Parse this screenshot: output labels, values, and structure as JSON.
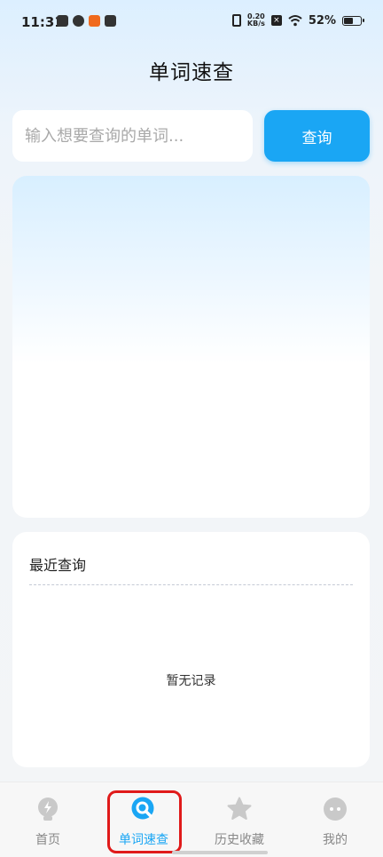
{
  "status_bar": {
    "time": "11:31",
    "net_speed_value": "0.20",
    "net_speed_unit": "KB/s",
    "battery_percent": "52%",
    "battery_level": 0.52
  },
  "page": {
    "title": "单词速查"
  },
  "search": {
    "placeholder": "输入想要查询的单词...",
    "button_label": "查询"
  },
  "recent": {
    "title": "最近查询",
    "empty_text": "暂无记录"
  },
  "nav": {
    "items": [
      {
        "label": "首页",
        "icon": "lightbulb-icon",
        "active": false
      },
      {
        "label": "单词速查",
        "icon": "search-icon",
        "active": true
      },
      {
        "label": "历史收藏",
        "icon": "star-icon",
        "active": false
      },
      {
        "label": "我的",
        "icon": "face-icon",
        "active": false
      }
    ]
  },
  "colors": {
    "accent": "#1aa6f4",
    "highlight": "#e01a1a"
  }
}
